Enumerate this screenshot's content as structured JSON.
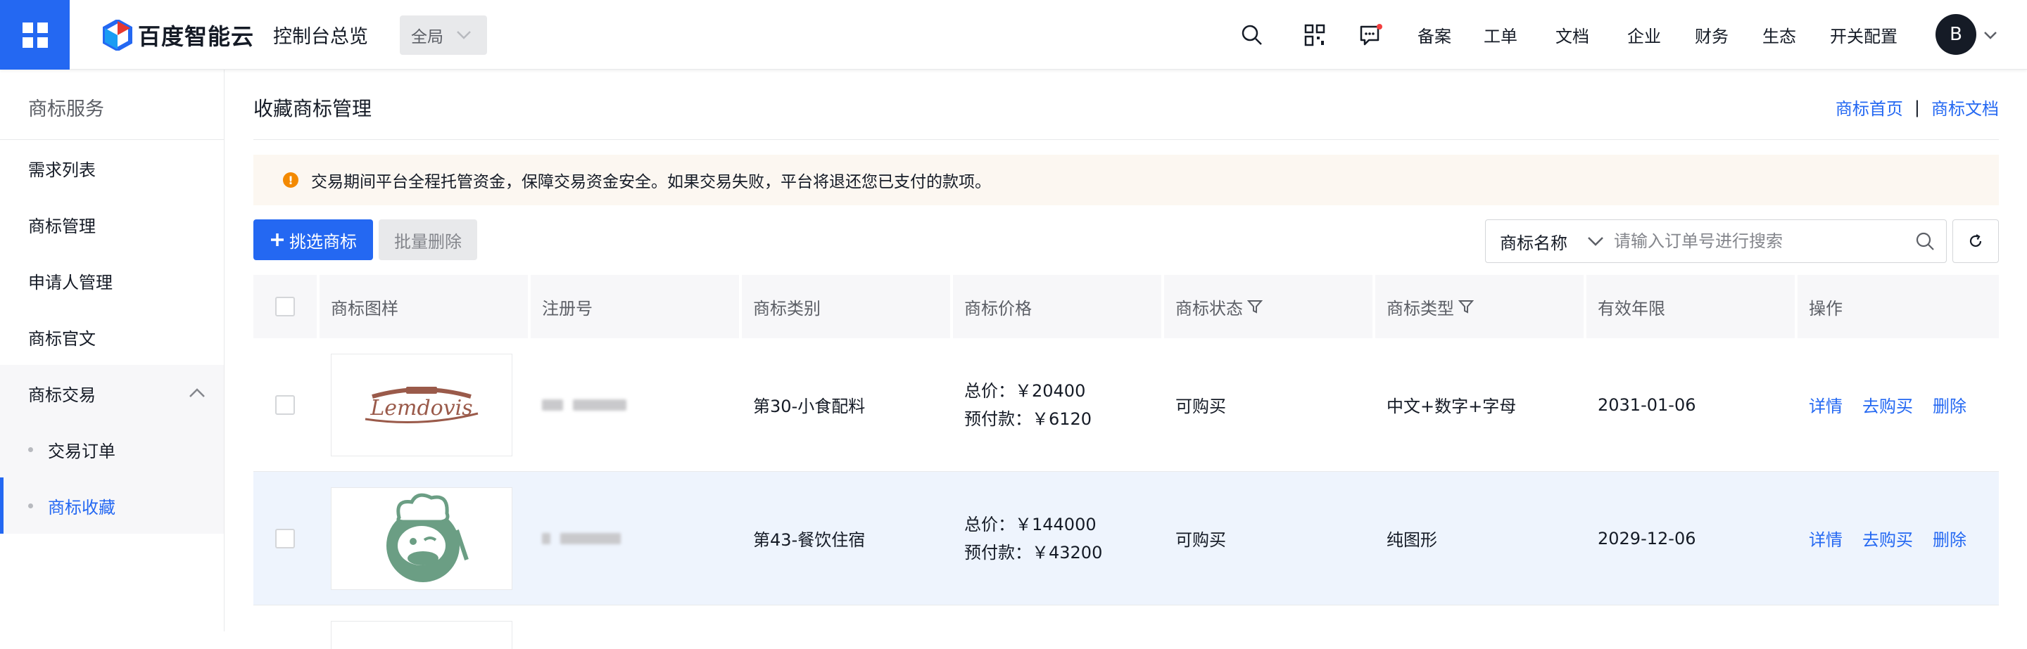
{
  "topbar": {
    "logo_text": "百度智能云",
    "console_title": "控制台总览",
    "region_label": "全局",
    "nav_items": [
      "备案",
      "工单",
      "文档",
      "企业",
      "财务",
      "生态",
      "开关配置"
    ],
    "avatar_letter": "B",
    "colors": {
      "brand": "#2468f2",
      "notification_dot": "#f33e3e"
    }
  },
  "sidebar": {
    "title": "商标服务",
    "items": [
      {
        "label": "需求列表"
      },
      {
        "label": "商标管理"
      },
      {
        "label": "申请人管理"
      },
      {
        "label": "商标官文"
      }
    ],
    "group": {
      "label": "商标交易",
      "expanded": true,
      "children": [
        {
          "label": "交易订单",
          "active": false
        },
        {
          "label": "商标收藏",
          "active": true
        }
      ]
    }
  },
  "main": {
    "title": "收藏商标管理",
    "links": {
      "home": "商标首页",
      "separator": "|",
      "docs": "商标文档"
    },
    "notice": "交易期间平台全程托管资金，保障交易资金安全。如果交易失败，平台将退还您已支付的款项。",
    "toolbar": {
      "add_label": "挑选商标",
      "batch_delete_label": "批量删除",
      "search_field": "商标名称",
      "search_placeholder": "请输入订单号进行搜索"
    },
    "table": {
      "columns": [
        "商标图样",
        "注册号",
        "商标类别",
        "商标价格",
        "商标状态",
        "商标类型",
        "有效年限",
        "操作"
      ],
      "rows": [
        {
          "image": "Lemdovis trademark logo",
          "reg_no": "",
          "category": "第30-小食配料",
          "total": "总价：￥20400",
          "deposit": "预付款：￥6120",
          "status": "可购买",
          "type": "中文+数字+字母",
          "expiry": "2031-01-06",
          "ops": [
            "详情",
            "去购买",
            "删除"
          ]
        },
        {
          "image": "chef duck trademark logo",
          "reg_no": "",
          "category": "第43-餐饮住宿",
          "total": "总价：￥144000",
          "deposit": "预付款：￥43200",
          "status": "可购买",
          "type": "纯图形",
          "expiry": "2029-12-06",
          "ops": [
            "详情",
            "去购买",
            "删除"
          ]
        }
      ]
    }
  }
}
